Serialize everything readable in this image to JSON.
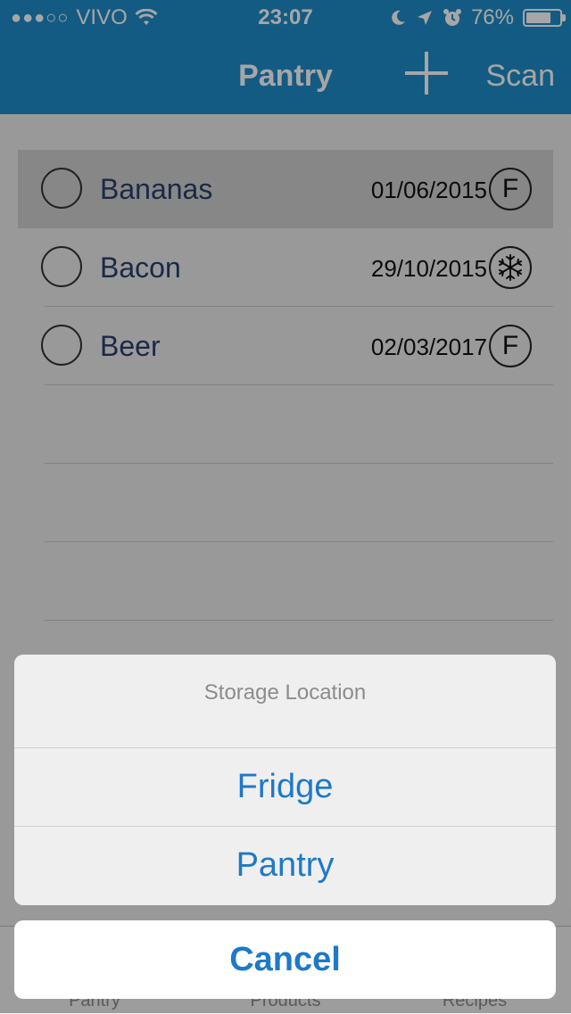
{
  "status_bar": {
    "signal": "●●●○○",
    "carrier": "VIVO",
    "time": "23:07",
    "battery_percent": "76%",
    "battery_level": 0.76
  },
  "nav": {
    "title": "Pantry",
    "add_icon": "plus-icon",
    "scan_label": "Scan"
  },
  "items": [
    {
      "name": "Bananas",
      "date": "01/06/2015",
      "location": "F",
      "location_icon": "fridge-letter-icon"
    },
    {
      "name": "Bacon",
      "date": "29/10/2015",
      "location": "",
      "location_icon": "snowflake-icon"
    },
    {
      "name": "Beer",
      "date": "02/03/2017",
      "location": "F",
      "location_icon": "fridge-letter-icon"
    }
  ],
  "tabs": [
    "Pantry",
    "Products",
    "Recipes"
  ],
  "action_sheet": {
    "title": "Storage Location",
    "options": [
      "Fridge",
      "Pantry"
    ],
    "cancel": "Cancel"
  },
  "colors": {
    "nav_bar": "#1e8cc8",
    "action_text": "#1d79c9"
  }
}
